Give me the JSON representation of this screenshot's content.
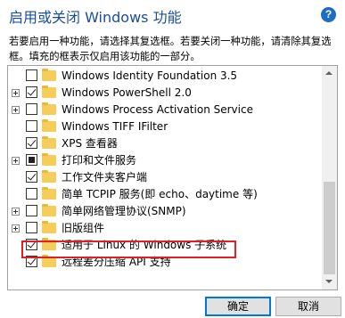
{
  "window": {
    "title": "启用或关闭 Windows 功能",
    "help_glyph": "?"
  },
  "description": "若要启用一种功能，请选择其复选框。若要关闭一种功能，请清除其复选框。填充的框表示仅启用该功能的一部分。",
  "features": [
    {
      "label": "Windows Identity Foundation 3.5",
      "expandable": false,
      "state": "unchecked"
    },
    {
      "label": "Windows PowerShell 2.0",
      "expandable": true,
      "state": "checked"
    },
    {
      "label": "Windows Process Activation Service",
      "expandable": true,
      "state": "unchecked"
    },
    {
      "label": "Windows TIFF IFilter",
      "expandable": false,
      "state": "unchecked"
    },
    {
      "label": "XPS 查看器",
      "expandable": false,
      "state": "checked"
    },
    {
      "label": "打印和文件服务",
      "expandable": true,
      "state": "partial"
    },
    {
      "label": "工作文件夹客户端",
      "expandable": false,
      "state": "checked"
    },
    {
      "label": "简单 TCPIP 服务(即 echo、daytime 等)",
      "expandable": false,
      "state": "unchecked"
    },
    {
      "label": "简单网络管理协议(SNMP)",
      "expandable": true,
      "state": "unchecked"
    },
    {
      "label": "旧版组件",
      "expandable": true,
      "state": "unchecked"
    },
    {
      "label": "适用于 Linux 的 Windows 子系统",
      "expandable": false,
      "state": "checked",
      "highlighted": true
    },
    {
      "label": "远程差分压缩 API 支持",
      "expandable": false,
      "state": "checked"
    }
  ],
  "buttons": {
    "ok": "确定",
    "cancel": "取消"
  },
  "colors": {
    "title": "#1b4e9a",
    "highlight_border": "#e02020",
    "folder": "#f5cd58",
    "ok_border": "#0078d7"
  }
}
